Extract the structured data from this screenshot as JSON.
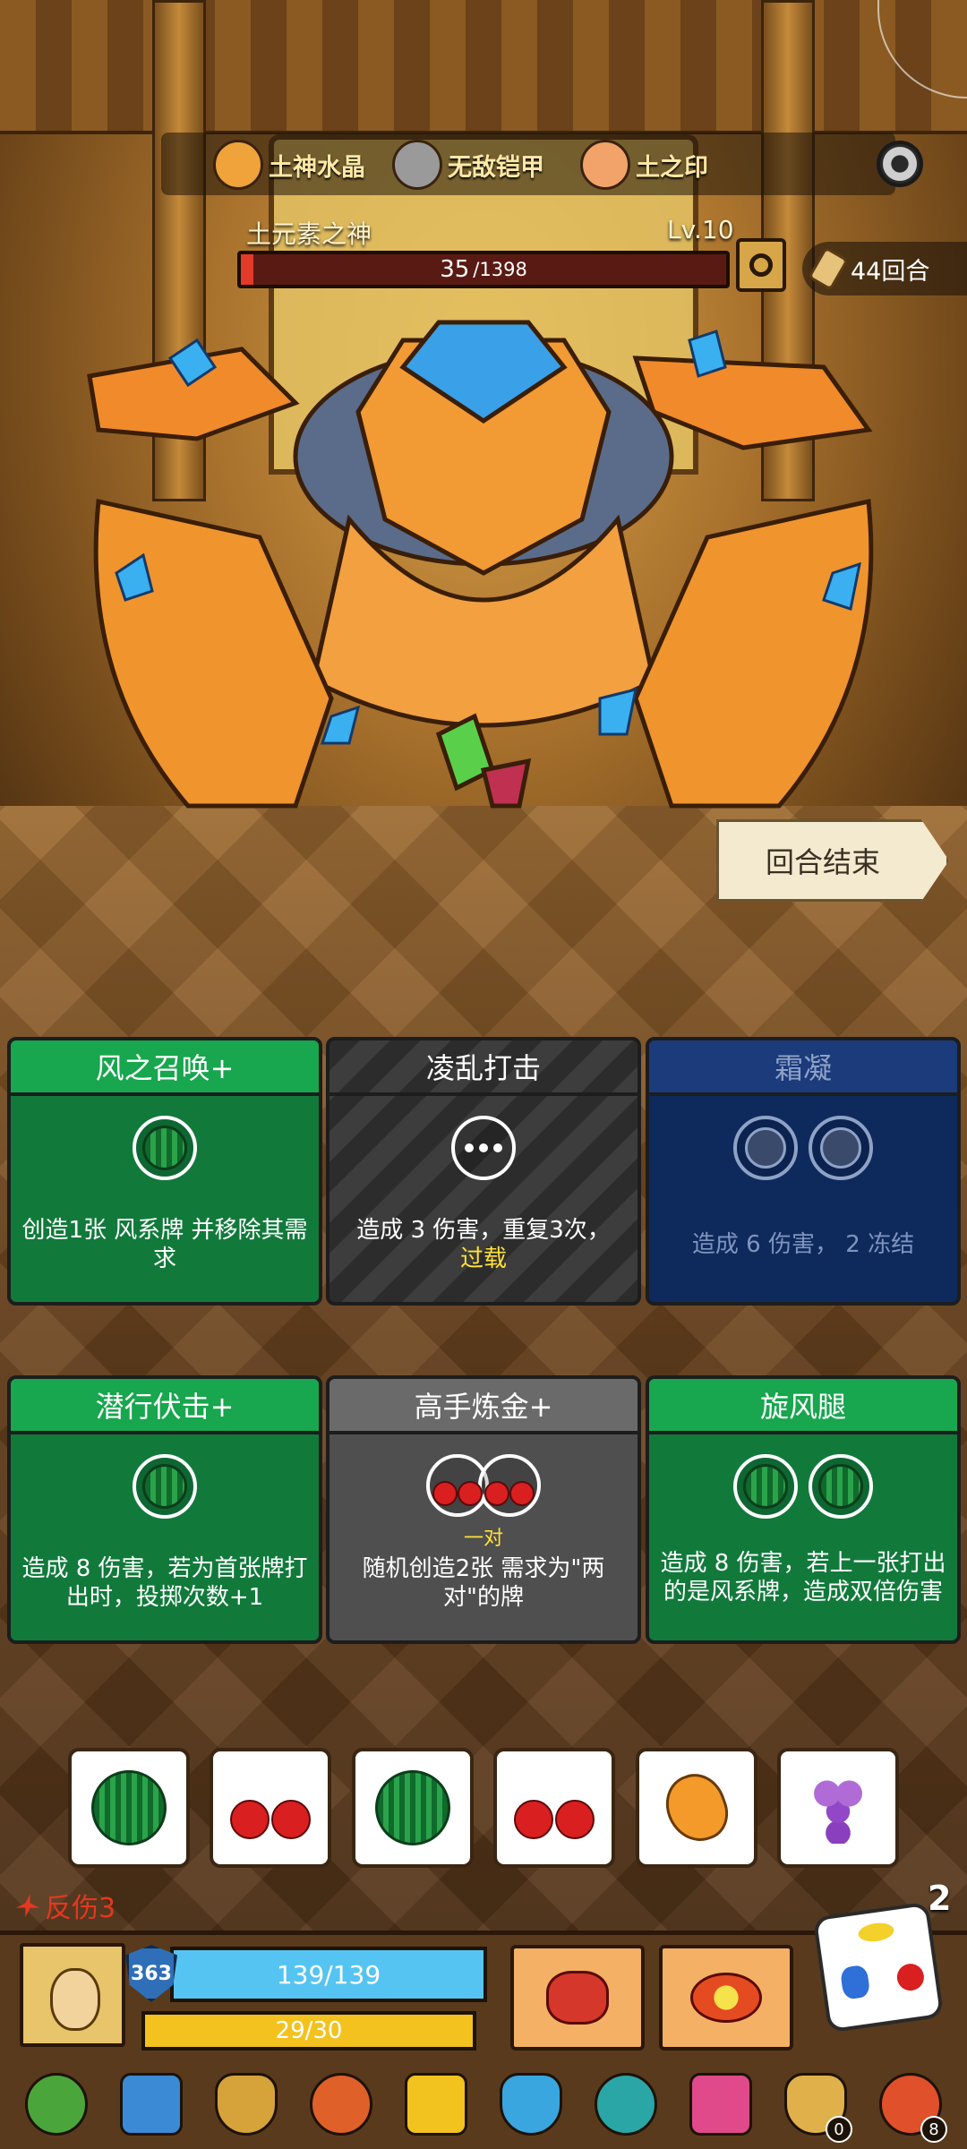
{
  "resources": [
    {
      "name": "土神水晶",
      "icon": "crystal-icon",
      "color": "#f0a33a"
    },
    {
      "name": "无敌铠甲",
      "icon": "armor-icon",
      "color": "#9a9a9a"
    },
    {
      "name": "土之印",
      "icon": "earth-seal-icon",
      "color": "#f2a36a"
    }
  ],
  "boss": {
    "name": "土元素之神",
    "level": "Lv.10",
    "hp_current": "35",
    "hp_max": "/1398",
    "hp_fraction": 0.025
  },
  "turns": "44回合",
  "end_turn_label": "回合结束",
  "cards": [
    {
      "title": "风之召唤+",
      "style": "green",
      "slots": [
        "melon"
      ],
      "desc": "创造1张 风系牌 并移除其需求",
      "badge": ""
    },
    {
      "title": "凌乱打击",
      "style": "dark",
      "slots": [
        "dots"
      ],
      "desc": "造成 3 伤害，重复3次，",
      "desc_highlight": "过载"
    },
    {
      "title": "霜凝",
      "style": "navy",
      "slots": [
        "snow",
        "snow"
      ],
      "desc": "造成 6 伤害， 2 冻结"
    },
    {
      "title": "潜行伏击+",
      "style": "green",
      "slots": [
        "melon"
      ],
      "desc": "造成 8 伤害，若为首张牌打出时，投掷次数+1"
    },
    {
      "title": "高手炼金+",
      "style": "gray",
      "slots": [
        "cherry",
        "cherry"
      ],
      "slot_label": "一对",
      "desc": "随机创造2张 需求为\"两对\"的牌"
    },
    {
      "title": "旋风腿",
      "style": "green",
      "slots": [
        "melon",
        "melon"
      ],
      "desc": "造成 8 伤害，若上一张打出的是风系牌，造成双倍伤害"
    }
  ],
  "dice": [
    "melon",
    "cherry",
    "melon",
    "cherry",
    "orange",
    "grape"
  ],
  "status": {
    "thorns": "反伤3"
  },
  "rolls_left": "2",
  "player": {
    "shield": "363",
    "hp": "139/139",
    "mp": "29/30"
  },
  "relics": [
    {
      "icon": "leaf-icon",
      "color": "#4aa63a",
      "count": ""
    },
    {
      "icon": "ice-crown-icon",
      "color": "#3a8ad6",
      "count": ""
    },
    {
      "icon": "bug-medal-icon",
      "color": "#d6a23a",
      "count": ""
    },
    {
      "icon": "meat-icon",
      "color": "#e0602a",
      "count": ""
    },
    {
      "icon": "gold-crown-icon",
      "color": "#f2c21f",
      "count": ""
    },
    {
      "icon": "blue-shield-icon",
      "color": "#3aa6e0",
      "count": ""
    },
    {
      "icon": "demon-mask-icon",
      "color": "#2aa6a6",
      "count": ""
    },
    {
      "icon": "feather-icon",
      "color": "#e04a8a",
      "count": ""
    },
    {
      "icon": "money-bag-icon",
      "color": "#e0b04a",
      "count": "0"
    },
    {
      "icon": "fire-pot-icon",
      "color": "#e0502a",
      "count": "8"
    }
  ]
}
